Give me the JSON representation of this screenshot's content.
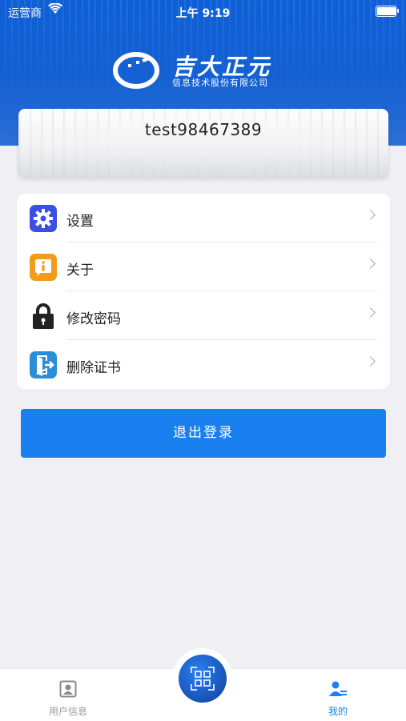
{
  "status_bar": {
    "carrier": "运营商",
    "time": "上午 9:19",
    "battery_level": 0.95
  },
  "brand": {
    "name": "吉大正元",
    "subtitle": "信息技术股份有限公司"
  },
  "user": {
    "username": "test98467389"
  },
  "menu": {
    "items": [
      {
        "label": "设置",
        "icon": "gear-icon",
        "color": "#3b4fe0"
      },
      {
        "label": "关于",
        "icon": "info-bubble-icon",
        "color": "#f29b1c"
      },
      {
        "label": "修改密码",
        "icon": "lock-icon",
        "color": "#222222"
      },
      {
        "label": "删除证书",
        "icon": "door-exit-icon",
        "color": "#2a8fd8"
      }
    ]
  },
  "logout": {
    "label": "退出登录",
    "color": "#1a80f0"
  },
  "tabbar": {
    "tabs": [
      {
        "label": "用户信息",
        "icon": "user-card-icon",
        "active": false
      },
      {
        "label": "我的",
        "icon": "profile-icon",
        "active": true
      }
    ],
    "center": {
      "icon": "qr-scan-icon"
    }
  },
  "colors": {
    "header": "#1560d2",
    "accent": "#1a80f0",
    "background": "#efeff4"
  }
}
